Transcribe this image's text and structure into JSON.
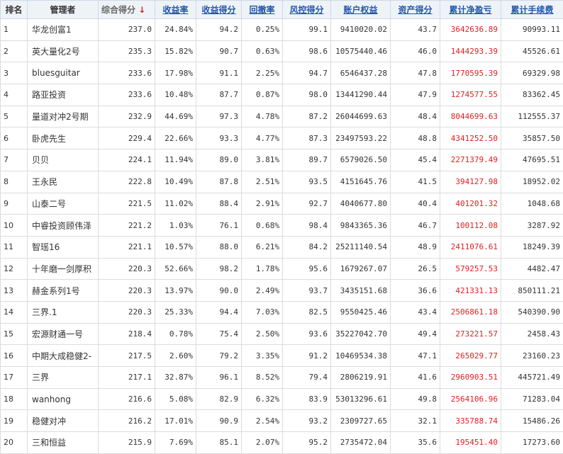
{
  "headers": {
    "rank": "排名",
    "manager": "管理者",
    "composite": "综合得分",
    "sort_arrow": "↓",
    "return_rate": "收益率",
    "return_score": "收益得分",
    "drawdown": "回撤率",
    "risk_score": "风控得分",
    "equity": "账户权益",
    "asset_score": "资产得分",
    "net_profit": "累计净盈亏",
    "fees": "累计手续费"
  },
  "rows": [
    {
      "rank": "1",
      "name": "华龙创富1",
      "composite": "237.0",
      "return_rate": "24.84%",
      "return_score": "94.2",
      "drawdown": "0.25%",
      "risk_score": "99.1",
      "equity": "9410020.02",
      "asset_score": "43.7",
      "net_profit": "3642636.89",
      "fees": "90993.11"
    },
    {
      "rank": "2",
      "name": "英大量化2号",
      "composite": "235.3",
      "return_rate": "15.82%",
      "return_score": "90.7",
      "drawdown": "0.63%",
      "risk_score": "98.6",
      "equity": "10575440.46",
      "asset_score": "46.0",
      "net_profit": "1444293.39",
      "fees": "45526.61"
    },
    {
      "rank": "3",
      "name": "bluesguitar",
      "composite": "233.6",
      "return_rate": "17.98%",
      "return_score": "91.1",
      "drawdown": "2.25%",
      "risk_score": "94.7",
      "equity": "6546437.28",
      "asset_score": "47.8",
      "net_profit": "1770595.39",
      "fees": "69329.98"
    },
    {
      "rank": "4",
      "name": "路亚投资",
      "composite": "233.6",
      "return_rate": "10.48%",
      "return_score": "87.7",
      "drawdown": "0.87%",
      "risk_score": "98.0",
      "equity": "13441290.44",
      "asset_score": "47.9",
      "net_profit": "1274577.55",
      "fees": "83362.45"
    },
    {
      "rank": "5",
      "name": "量道对冲2号期",
      "composite": "232.9",
      "return_rate": "44.69%",
      "return_score": "97.3",
      "drawdown": "4.78%",
      "risk_score": "87.2",
      "equity": "26044699.63",
      "asset_score": "48.4",
      "net_profit": "8044699.63",
      "fees": "112555.37"
    },
    {
      "rank": "6",
      "name": "卧虎先生",
      "composite": "229.4",
      "return_rate": "22.66%",
      "return_score": "93.3",
      "drawdown": "4.77%",
      "risk_score": "87.3",
      "equity": "23497593.22",
      "asset_score": "48.8",
      "net_profit": "4341252.50",
      "fees": "35857.50"
    },
    {
      "rank": "7",
      "name": "贝贝",
      "composite": "224.1",
      "return_rate": "11.94%",
      "return_score": "89.0",
      "drawdown": "3.81%",
      "risk_score": "89.7",
      "equity": "6579026.50",
      "asset_score": "45.4",
      "net_profit": "2271379.49",
      "fees": "47695.51"
    },
    {
      "rank": "8",
      "name": "王永民",
      "composite": "222.8",
      "return_rate": "10.49%",
      "return_score": "87.8",
      "drawdown": "2.51%",
      "risk_score": "93.5",
      "equity": "4151645.76",
      "asset_score": "41.5",
      "net_profit": "394127.98",
      "fees": "18952.02"
    },
    {
      "rank": "9",
      "name": "山泰二号",
      "composite": "221.5",
      "return_rate": "11.02%",
      "return_score": "88.4",
      "drawdown": "2.91%",
      "risk_score": "92.7",
      "equity": "4040677.80",
      "asset_score": "40.4",
      "net_profit": "401201.32",
      "fees": "1048.68"
    },
    {
      "rank": "10",
      "name": "中睿投资顾伟泽",
      "composite": "221.2",
      "return_rate": "1.03%",
      "return_score": "76.1",
      "drawdown": "0.68%",
      "risk_score": "98.4",
      "equity": "9843365.36",
      "asset_score": "46.7",
      "net_profit": "100112.08",
      "fees": "3287.92"
    },
    {
      "rank": "11",
      "name": "智瑶16",
      "composite": "221.1",
      "return_rate": "10.57%",
      "return_score": "88.0",
      "drawdown": "6.21%",
      "risk_score": "84.2",
      "equity": "25211140.54",
      "asset_score": "48.9",
      "net_profit": "2411076.61",
      "fees": "18249.39"
    },
    {
      "rank": "12",
      "name": "十年磨一剑厚积",
      "composite": "220.3",
      "return_rate": "52.66%",
      "return_score": "98.2",
      "drawdown": "1.78%",
      "risk_score": "95.6",
      "equity": "1679267.07",
      "asset_score": "26.5",
      "net_profit": "579257.53",
      "fees": "4482.47"
    },
    {
      "rank": "13",
      "name": "赫金系列1号",
      "composite": "220.3",
      "return_rate": "13.97%",
      "return_score": "90.0",
      "drawdown": "2.49%",
      "risk_score": "93.7",
      "equity": "3435151.68",
      "asset_score": "36.6",
      "net_profit": "421331.13",
      "fees": "850111.21"
    },
    {
      "rank": "14",
      "name": "三界.1",
      "composite": "220.3",
      "return_rate": "25.33%",
      "return_score": "94.4",
      "drawdown": "7.03%",
      "risk_score": "82.5",
      "equity": "9550425.46",
      "asset_score": "43.4",
      "net_profit": "2506861.18",
      "fees": "540390.90"
    },
    {
      "rank": "15",
      "name": "宏源财通一号",
      "composite": "218.4",
      "return_rate": "0.78%",
      "return_score": "75.4",
      "drawdown": "2.50%",
      "risk_score": "93.6",
      "equity": "35227042.70",
      "asset_score": "49.4",
      "net_profit": "273221.57",
      "fees": "2458.43"
    },
    {
      "rank": "16",
      "name": "中期大成稳健2-",
      "composite": "217.5",
      "return_rate": "2.60%",
      "return_score": "79.2",
      "drawdown": "3.35%",
      "risk_score": "91.2",
      "equity": "10469534.38",
      "asset_score": "47.1",
      "net_profit": "265029.77",
      "fees": "23160.23"
    },
    {
      "rank": "17",
      "name": "三界",
      "composite": "217.1",
      "return_rate": "32.87%",
      "return_score": "96.1",
      "drawdown": "8.52%",
      "risk_score": "79.4",
      "equity": "2806219.91",
      "asset_score": "41.6",
      "net_profit": "2960903.51",
      "fees": "445721.49"
    },
    {
      "rank": "18",
      "name": "wanhong",
      "composite": "216.6",
      "return_rate": "5.08%",
      "return_score": "82.9",
      "drawdown": "6.32%",
      "risk_score": "83.9",
      "equity": "53013296.61",
      "asset_score": "49.8",
      "net_profit": "2564106.96",
      "fees": "71283.04"
    },
    {
      "rank": "19",
      "name": "稳健对冲",
      "composite": "216.2",
      "return_rate": "17.01%",
      "return_score": "90.9",
      "drawdown": "2.54%",
      "risk_score": "93.2",
      "equity": "2309727.65",
      "asset_score": "32.1",
      "net_profit": "335788.74",
      "fees": "15486.26"
    },
    {
      "rank": "20",
      "name": "三和恒益",
      "composite": "215.9",
      "return_rate": "7.69%",
      "return_score": "85.1",
      "drawdown": "2.07%",
      "risk_score": "95.2",
      "equity": "2735472.04",
      "asset_score": "35.6",
      "net_profit": "195451.40",
      "fees": "17273.60"
    }
  ],
  "colors": {
    "header_bg": "#eef3f8",
    "header_link": "#2255aa",
    "negative_red": "#e02020",
    "text": "#333333",
    "grid": "#dcdcdc"
  }
}
